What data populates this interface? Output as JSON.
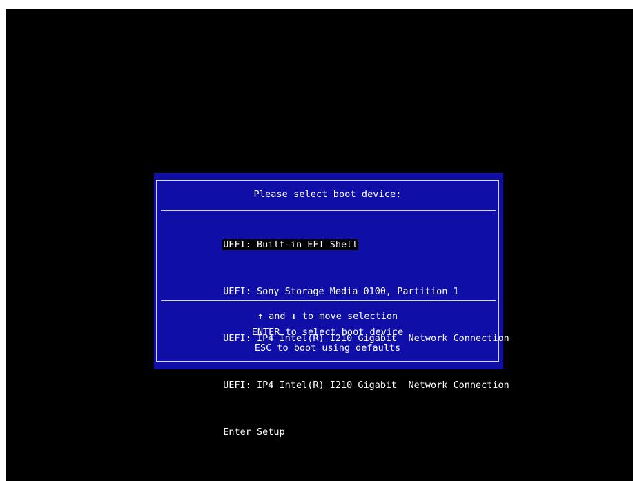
{
  "screen": {
    "background_color": "#000000"
  },
  "dialog": {
    "title": "Please select boot device:",
    "background_color": "#0f0fa8",
    "devices": [
      {
        "label": "UEFI: Built-in EFI Shell",
        "selected": true
      },
      {
        "label": "UEFI: Sony Storage Media 0100, Partition 1",
        "selected": false
      },
      {
        "label": "UEFI: IP4 Intel(R) I210 Gigabit  Network Connection",
        "selected": false
      },
      {
        "label": "UEFI: IP4 Intel(R) I210 Gigabit  Network Connection",
        "selected": false
      },
      {
        "label": "Enter Setup",
        "selected": false
      }
    ],
    "help": {
      "up_arrow": "↑",
      "and_text": " and ",
      "down_arrow": "↓",
      "move_text": " to move selection",
      "enter_line": "ENTER to select boot device",
      "esc_line": "ESC to boot using defaults"
    }
  }
}
